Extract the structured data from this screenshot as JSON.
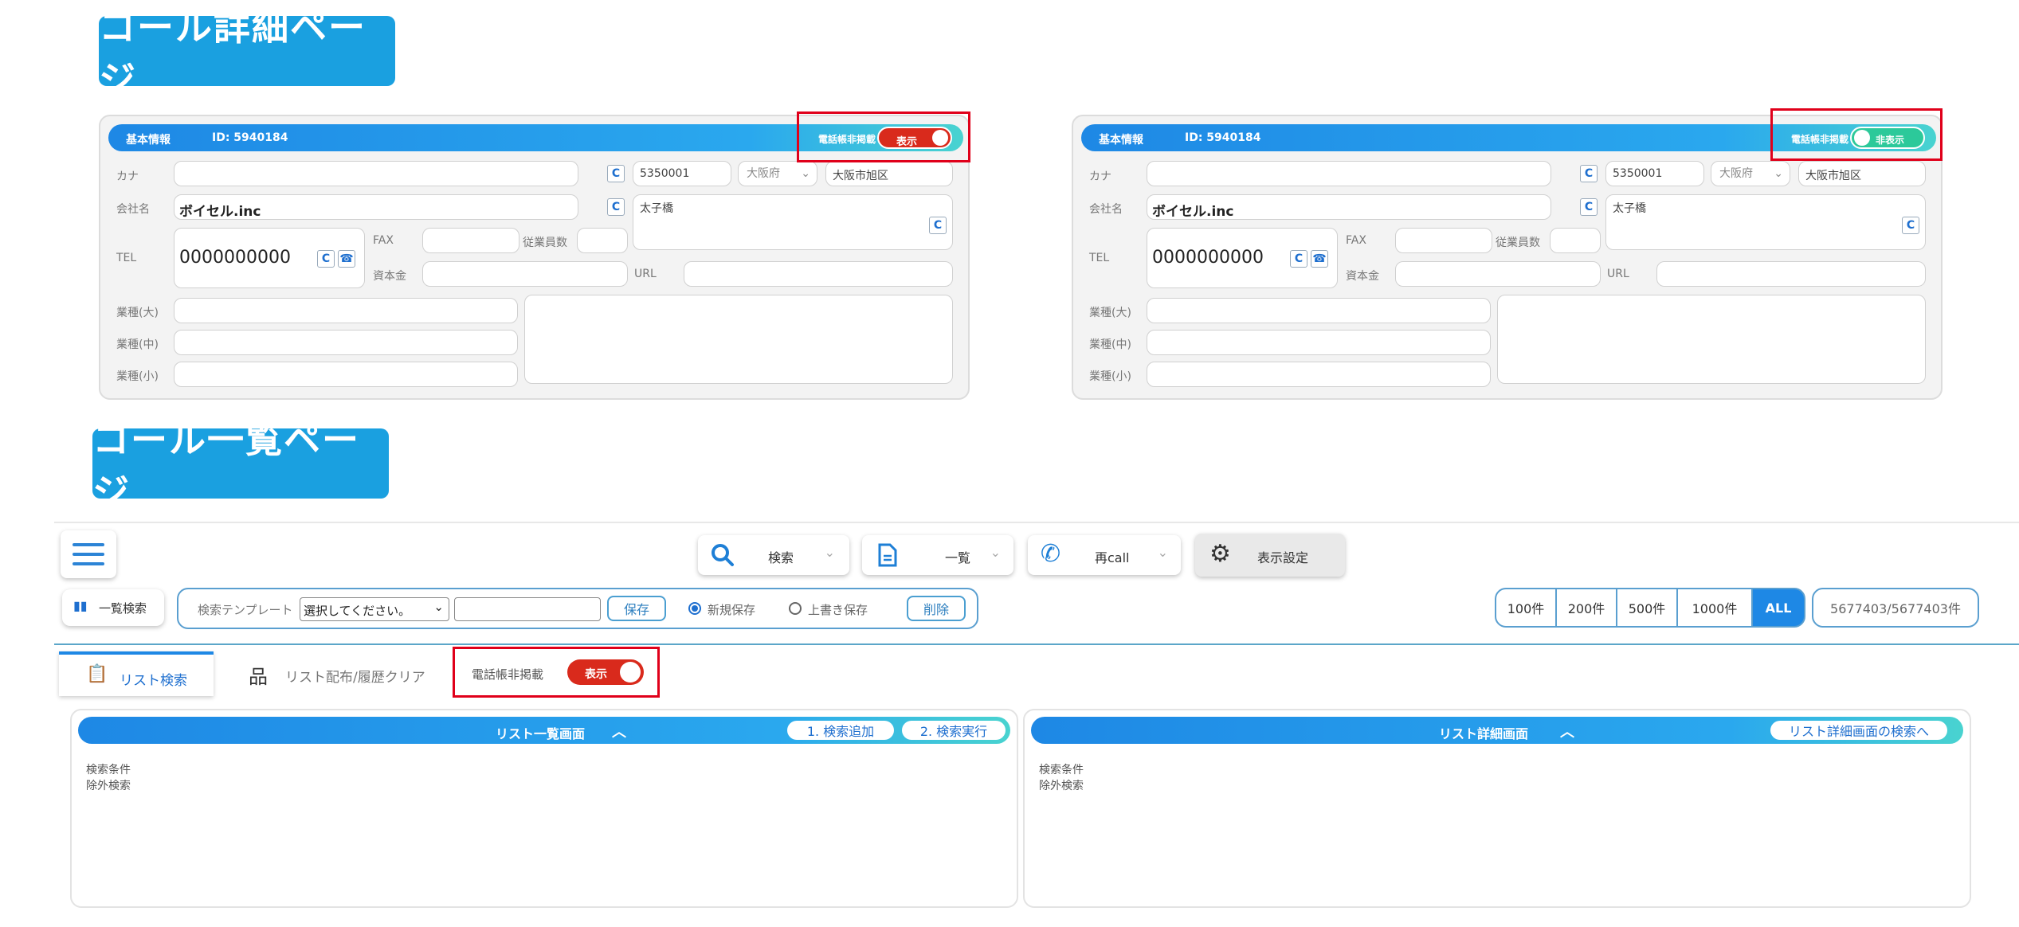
{
  "sections": {
    "detail_title": "コール詳細ページ",
    "list_title": "コール一覧ページ"
  },
  "detail_card": {
    "header_left": "基本情報",
    "header_id": "ID: 5940184",
    "toggle_label": "電話帳非掲載",
    "labels": {
      "kana": "カナ",
      "company": "会社名",
      "tel": "TEL",
      "fax": "FAX",
      "employees": "従業員数",
      "capital": "資本金",
      "url": "URL",
      "industry_l": "業種(大)",
      "industry_m": "業種(中)",
      "industry_s": "業種(小)"
    },
    "values": {
      "postal": "5350001",
      "prefecture": "大阪府",
      "city": "大阪市旭区",
      "company": "ボイセル.inc",
      "address2": "太子橋",
      "tel": "0000000000"
    }
  },
  "detail_left_toggle": {
    "state_label": "表示"
  },
  "detail_right_toggle": {
    "state_label": "非表示"
  },
  "list_page": {
    "toolbar": {
      "search": "検索",
      "list": "一覧",
      "recall": "再call",
      "display_settings": "表示設定"
    },
    "search_bar": {
      "list_search_btn": "一覧検索",
      "template_label": "検索テンプレート",
      "template_select": "選択してください。",
      "save_btn": "保存",
      "new_save": "新規保存",
      "overwrite_save": "上書き保存",
      "delete_btn": "削除"
    },
    "counts": [
      "100件",
      "200件",
      "500件",
      "1000件",
      "ALL"
    ],
    "total": "5677403/5677403件",
    "tabs": {
      "list_search": "リスト検索",
      "distribute": "リスト配布/履歴クリア",
      "toggle_label": "電話帳非掲載",
      "toggle_state": "表示"
    },
    "left_panel": {
      "title": "リスト一覧画面",
      "btn1": "1. 検索追加",
      "btn2": "2. 検索実行",
      "cond": "検索条件",
      "exclude": "除外検索"
    },
    "right_panel": {
      "title": "リスト詳細画面",
      "btn": "リスト詳細画面の検索へ",
      "cond": "検索条件",
      "exclude": "除外検索"
    }
  },
  "colors": {
    "banner": "#1aa0e0",
    "toggle_on": "#d92a1c",
    "toggle_off": "#2cc99a",
    "highlight_box": "#e0001a"
  }
}
